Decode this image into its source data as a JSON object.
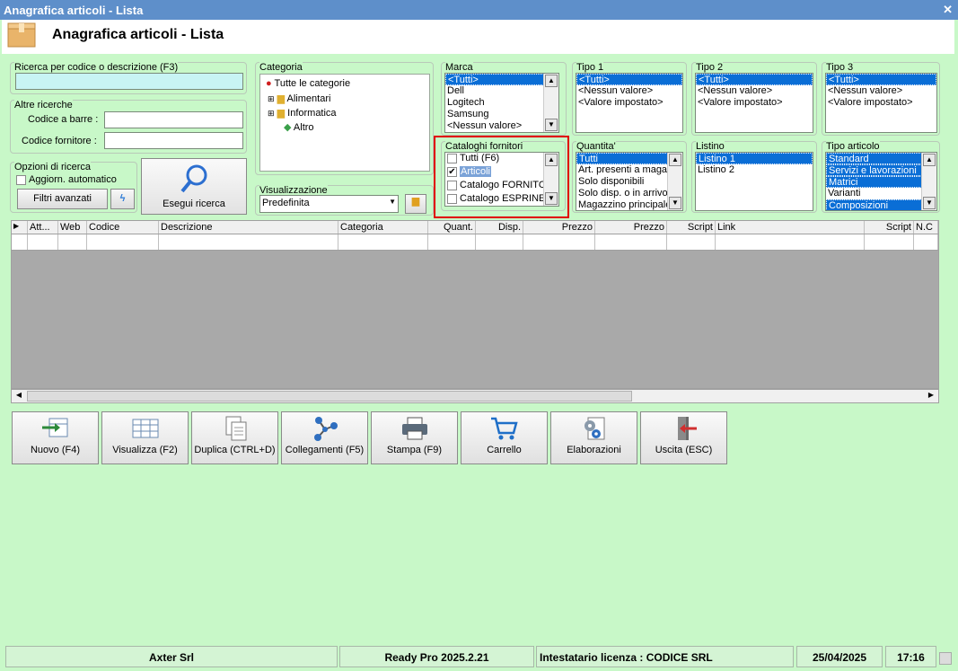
{
  "window": {
    "title": "Anagrafica articoli  - Lista",
    "header": "Anagrafica articoli  - Lista"
  },
  "search": {
    "label": "Ricerca per codice o descrizione (F3)",
    "value": ""
  },
  "altre": {
    "label": "Altre ricerche",
    "barcode_label": "Codice a barre :",
    "supplier_label": "Codice fornitore :"
  },
  "opzioni": {
    "label": "Opzioni di ricerca",
    "auto_label": "Aggiorn. automatico",
    "filtri_label": "Filtri avanzati"
  },
  "esegui": {
    "label": "Esegui ricerca"
  },
  "categoria": {
    "label": "Categoria",
    "root": "Tutte le categorie",
    "items": [
      "Alimentari",
      "Informatica",
      "Altro"
    ]
  },
  "visualizzazione": {
    "label": "Visualizzazione",
    "value": "Predefinita"
  },
  "marca": {
    "label": "Marca",
    "items": [
      "<Tutti>",
      "Dell",
      "Logitech",
      "Samsung",
      "<Nessun valore>"
    ]
  },
  "tipo1": {
    "label": "Tipo 1",
    "items": [
      "<Tutti>",
      "<Nessun valore>",
      "<Valore impostato>"
    ]
  },
  "tipo2": {
    "label": "Tipo 2",
    "items": [
      "<Tutti>",
      "<Nessun valore>",
      "<Valore impostato>"
    ]
  },
  "tipo3": {
    "label": "Tipo 3",
    "items": [
      "<Tutti>",
      "<Nessun valore>",
      "<Valore impostato>"
    ]
  },
  "cataloghi": {
    "label": "Cataloghi fornitori",
    "items": [
      "Tutti (F6)",
      "Articoli",
      "Catalogo FORNITOR",
      "Catalogo ESPRINET"
    ]
  },
  "quantita": {
    "label": "Quantita'",
    "items": [
      "Tutti",
      "Art. presenti a magaz",
      "Solo disponibili",
      "Solo disp. o in arrivo",
      "Magazzino principale"
    ]
  },
  "listino": {
    "label": "Listino",
    "items": [
      "Listino 1",
      "Listino 2"
    ]
  },
  "tipo_articolo": {
    "label": "Tipo articolo",
    "items": [
      "Standard",
      "Servizi e lavorazioni",
      "Matrici",
      "Varianti",
      "Composizioni"
    ]
  },
  "grid": {
    "columns": [
      "Att...",
      "Web",
      "Codice",
      "Descrizione",
      "Categoria",
      "Quant.",
      "Disp.",
      "Prezzo",
      "Prezzo",
      "Script",
      "Link",
      "Script",
      "N.C"
    ]
  },
  "toolbar": {
    "nuovo": "Nuovo (F4)",
    "visualizza": "Visualizza (F2)",
    "duplica": "Duplica (CTRL+D)",
    "collegamenti": "Collegamenti (F5)",
    "stampa": "Stampa (F9)",
    "carrello": "Carrello",
    "elaborazioni": "Elaborazioni",
    "uscita": "Uscita (ESC)"
  },
  "statusbar": {
    "company": "Axter Srl",
    "version": "Ready Pro 2025.2.21",
    "license": "Intestatario licenza : CODICE SRL",
    "date": "25/04/2025",
    "time": "17:16"
  },
  "colors": {
    "accent": "#0a6ed6",
    "background": "#c8f8c8",
    "titlebar": "#5e8fca",
    "highlight_box": "#e00000"
  }
}
